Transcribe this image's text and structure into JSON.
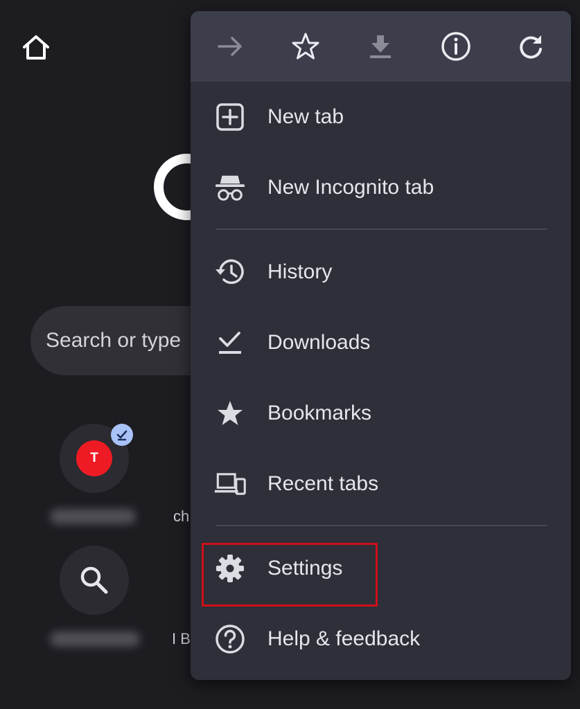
{
  "background": {
    "search_placeholder": "Search or type",
    "shortcuts": [
      {
        "avatar_letter": "T",
        "peek_text": "ch"
      },
      {
        "peek_text": "I B"
      }
    ]
  },
  "toolbar": {
    "icons": [
      "forward-icon",
      "bookmark-star-icon",
      "download-icon",
      "info-icon",
      "reload-icon"
    ]
  },
  "menu": {
    "items": [
      {
        "label": "New tab",
        "icon": "new-tab-icon"
      },
      {
        "label": "New Incognito tab",
        "icon": "incognito-icon"
      },
      {
        "label": "History",
        "icon": "history-icon"
      },
      {
        "label": "Downloads",
        "icon": "downloads-icon"
      },
      {
        "label": "Bookmarks",
        "icon": "bookmarks-icon"
      },
      {
        "label": "Recent tabs",
        "icon": "recent-tabs-icon"
      },
      {
        "label": "Settings",
        "icon": "gear-icon"
      },
      {
        "label": "Help & feedback",
        "icon": "help-icon"
      }
    ]
  },
  "colors": {
    "page_bg": "#1c1c21",
    "menu_bg": "#2e2f38",
    "toolbar_bg": "#3d3e4c",
    "highlight": "#d0101a",
    "avatar_red": "#ee1b24",
    "badge_blue": "#a9c2f7"
  }
}
